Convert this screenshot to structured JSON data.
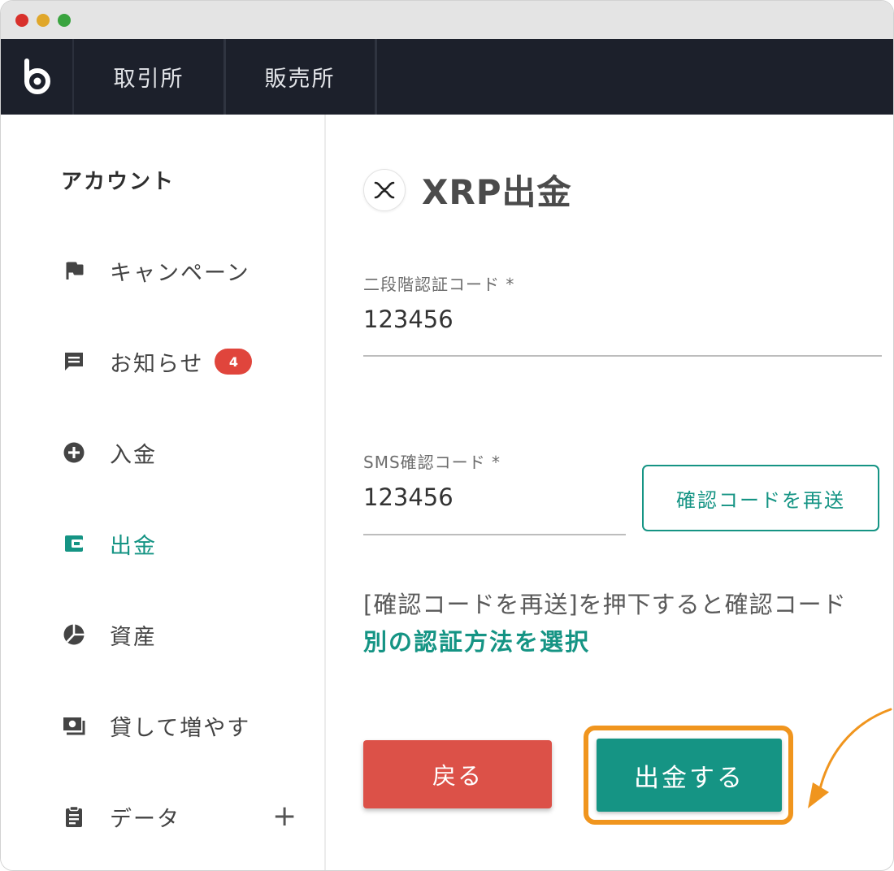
{
  "nav": {
    "tabs": [
      {
        "label": "取引所"
      },
      {
        "label": "販売所"
      }
    ]
  },
  "sidebar": {
    "title": "アカウント",
    "items": [
      {
        "label": "キャンペーン",
        "icon": "flag-icon"
      },
      {
        "label": "お知らせ",
        "icon": "message-icon",
        "badge": "4"
      },
      {
        "label": "入金",
        "icon": "plus-circle-icon"
      },
      {
        "label": "出金",
        "icon": "wallet-icon",
        "active": true
      },
      {
        "label": "資産",
        "icon": "pie-chart-icon"
      },
      {
        "label": "貸して増やす",
        "icon": "money-icon"
      },
      {
        "label": "データ",
        "icon": "clipboard-icon"
      }
    ],
    "data_expand": "+"
  },
  "main": {
    "title": "XRP出金",
    "two_factor": {
      "label": "二段階認証コード *",
      "value": "123456"
    },
    "sms": {
      "label": "SMS確認コード *",
      "value": "123456",
      "resend_label": "確認コードを再送"
    },
    "notice": "[確認コードを再送]を押下すると確認コード",
    "alt_method_link": "別の認証方法を選択",
    "back_label": "戻る",
    "withdraw_label": "出金する"
  },
  "colors": {
    "accent": "#159484",
    "danger": "#dc5148",
    "highlight": "#f0951e",
    "navbar": "#1c202b"
  }
}
